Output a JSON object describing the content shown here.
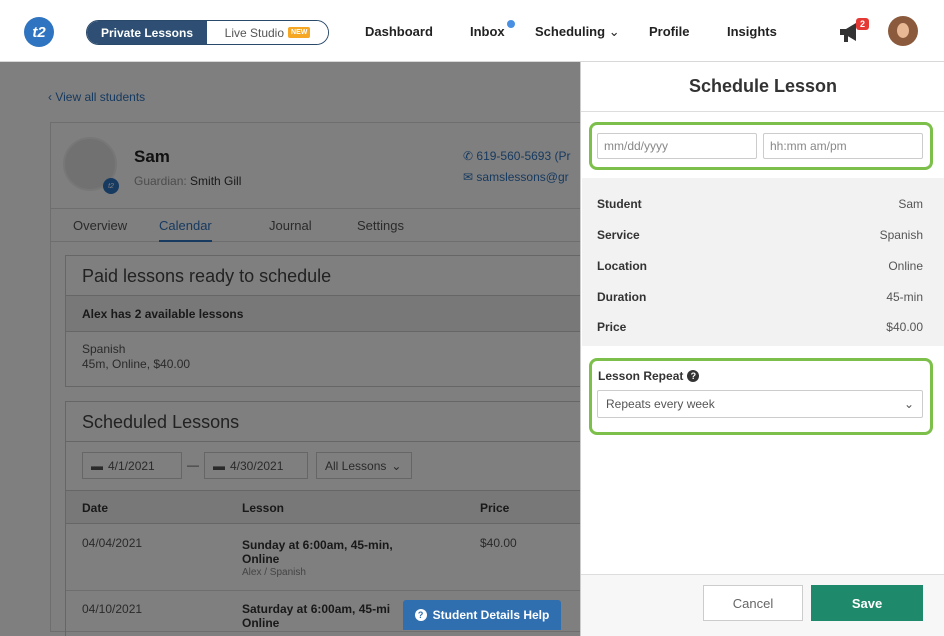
{
  "nav": {
    "logo": "t2",
    "segment_private": "Private Lessons",
    "segment_live": "Live Studio",
    "new_badge": "NEW",
    "links": [
      "Dashboard",
      "Inbox",
      "Scheduling",
      "Profile",
      "Insights"
    ],
    "scheduling_caret": "⌄",
    "notification_count": "2"
  },
  "back_link": "‹ View all students",
  "student": {
    "name": "Sam",
    "guardian_label": "Guardian:",
    "guardian_name": "Smith Gill",
    "phone": "619-560-5693 (Pr",
    "email": "samslessons@gr"
  },
  "tabs": [
    "Overview",
    "Calendar",
    "Journal",
    "Settings"
  ],
  "paid": {
    "title": "Paid lessons ready to schedule",
    "available": "Alex has 2 available lessons",
    "service": "Spanish",
    "details": "45m, Online, $40.00"
  },
  "scheduled": {
    "title": "Scheduled Lessons",
    "start_date": "4/1/2021",
    "dash": "—",
    "end_date": "4/30/2021",
    "filter": "All Lessons",
    "headers": [
      "Date",
      "Lesson",
      "Price"
    ],
    "rows": [
      {
        "date": "04/04/2021",
        "lesson1": "Sunday at 6:00am, 45-min,",
        "lesson2": "Online",
        "meta": "Alex / Spanish",
        "price": "$40.00"
      },
      {
        "date": "04/10/2021",
        "lesson1": "Saturday at 6:00am, 45-mi",
        "lesson2": "Online",
        "meta": "",
        "price": ""
      }
    ]
  },
  "help_button": "Student Details Help",
  "panel": {
    "title": "Schedule Lesson",
    "date_placeholder": "mm/dd/yyyy",
    "time_placeholder": "hh:mm am/pm",
    "summary": [
      {
        "key": "Student",
        "value": "Sam"
      },
      {
        "key": "Service",
        "value": "Spanish"
      },
      {
        "key": "Location",
        "value": "Online"
      },
      {
        "key": "Duration",
        "value": "45-min"
      },
      {
        "key": "Price",
        "value": "$40.00"
      }
    ],
    "repeat_label": "Lesson Repeat",
    "repeat_value": "Repeats every week",
    "cancel": "Cancel",
    "save": "Save"
  },
  "colors": {
    "highlight": "#7cc04b",
    "save": "#1f8a6b",
    "brand": "#2f74c0",
    "segment": "#2e4f73"
  }
}
